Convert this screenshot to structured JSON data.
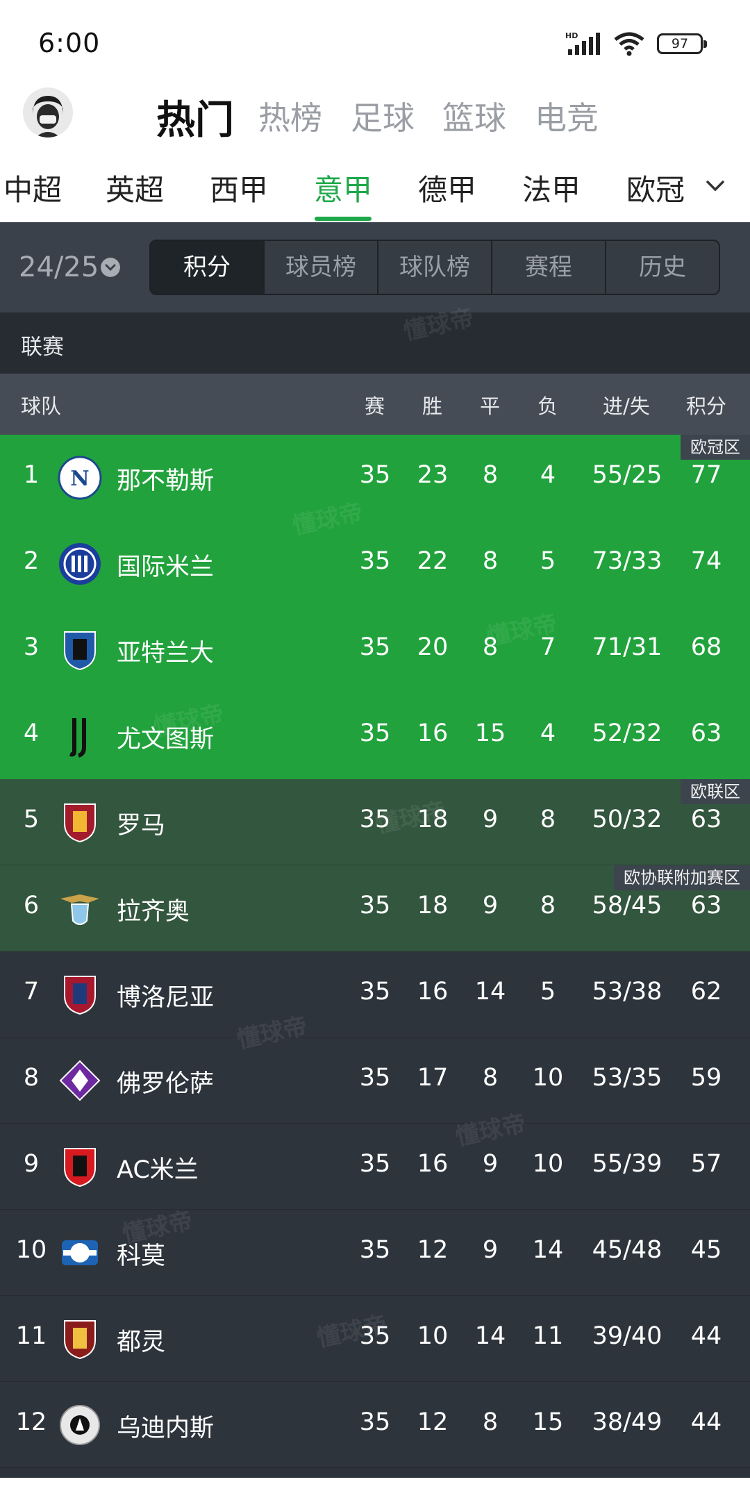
{
  "status": {
    "time": "6:00",
    "battery": "97"
  },
  "top_nav": {
    "main_tabs": [
      "热门",
      "热榜",
      "足球",
      "篮球",
      "电竞"
    ],
    "active_main": 0,
    "league_tabs": [
      "中超",
      "英超",
      "西甲",
      "意甲",
      "德甲",
      "法甲",
      "欧冠"
    ],
    "active_league": 3
  },
  "sub_header": {
    "season": "24/25",
    "segments": [
      "积分",
      "球员榜",
      "球队榜",
      "赛程",
      "历史"
    ],
    "active_segment": 0
  },
  "table": {
    "section_label": "联赛",
    "columns": {
      "team": "球队",
      "played": "赛",
      "win": "胜",
      "draw": "平",
      "loss": "负",
      "goals": "进/失",
      "points": "积分"
    },
    "zones": {
      "ucl": "欧冠区",
      "uel": "欧联区",
      "uecl": "欧协联附加赛区"
    },
    "rows": [
      {
        "rank": "1",
        "team": "那不勒斯",
        "played": "35",
        "win": "23",
        "draw": "8",
        "loss": "4",
        "goals": "55/25",
        "points": "77"
      },
      {
        "rank": "2",
        "team": "国际米兰",
        "played": "35",
        "win": "22",
        "draw": "8",
        "loss": "5",
        "goals": "73/33",
        "points": "74"
      },
      {
        "rank": "3",
        "team": "亚特兰大",
        "played": "35",
        "win": "20",
        "draw": "8",
        "loss": "7",
        "goals": "71/31",
        "points": "68"
      },
      {
        "rank": "4",
        "team": "尤文图斯",
        "played": "35",
        "win": "16",
        "draw": "15",
        "loss": "4",
        "goals": "52/32",
        "points": "63"
      },
      {
        "rank": "5",
        "team": "罗马",
        "played": "35",
        "win": "18",
        "draw": "9",
        "loss": "8",
        "goals": "50/32",
        "points": "63"
      },
      {
        "rank": "6",
        "team": "拉齐奥",
        "played": "35",
        "win": "18",
        "draw": "9",
        "loss": "8",
        "goals": "58/45",
        "points": "63"
      },
      {
        "rank": "7",
        "team": "博洛尼亚",
        "played": "35",
        "win": "16",
        "draw": "14",
        "loss": "5",
        "goals": "53/38",
        "points": "62"
      },
      {
        "rank": "8",
        "team": "佛罗伦萨",
        "played": "35",
        "win": "17",
        "draw": "8",
        "loss": "10",
        "goals": "53/35",
        "points": "59"
      },
      {
        "rank": "9",
        "team": "AC米兰",
        "played": "35",
        "win": "16",
        "draw": "9",
        "loss": "10",
        "goals": "55/39",
        "points": "57"
      },
      {
        "rank": "10",
        "team": "科莫",
        "played": "35",
        "win": "12",
        "draw": "9",
        "loss": "14",
        "goals": "45/48",
        "points": "45"
      },
      {
        "rank": "11",
        "team": "都灵",
        "played": "35",
        "win": "10",
        "draw": "14",
        "loss": "11",
        "goals": "39/40",
        "points": "44"
      },
      {
        "rank": "12",
        "team": "乌迪内斯",
        "played": "35",
        "win": "12",
        "draw": "8",
        "loss": "15",
        "goals": "38/49",
        "points": "44"
      }
    ]
  },
  "badge_labels": {
    "n1": "N",
    "n4": "J"
  },
  "watermark": "懂球帝"
}
